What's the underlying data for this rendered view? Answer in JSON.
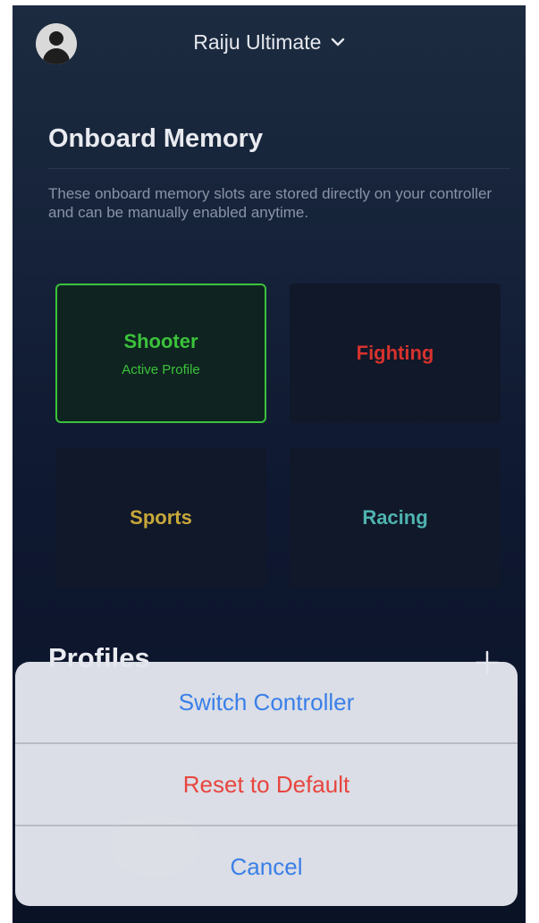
{
  "header": {
    "device_name": "Raiju Ultimate"
  },
  "onboard_memory": {
    "title": "Onboard Memory",
    "description": "These onboard memory slots are stored directly on your controller and can be manually enabled anytime.",
    "slots": [
      {
        "name": "Shooter",
        "subtitle": "Active Profile",
        "color": "#3bc23b",
        "active": true
      },
      {
        "name": "Fighting",
        "color": "#d7322d",
        "active": false
      },
      {
        "name": "Sports",
        "color": "#c9a83a",
        "active": false
      },
      {
        "name": "Racing",
        "color": "#4fb3b0",
        "active": false
      }
    ]
  },
  "profiles": {
    "title": "Profiles",
    "add_icon": "plus-icon"
  },
  "action_sheet": {
    "switch_label": "Switch Controller",
    "reset_label": "Reset to Default",
    "cancel_label": "Cancel",
    "switch_color": "#3a7fe8",
    "reset_color": "#e8453f",
    "cancel_color": "#3a7fe8"
  }
}
